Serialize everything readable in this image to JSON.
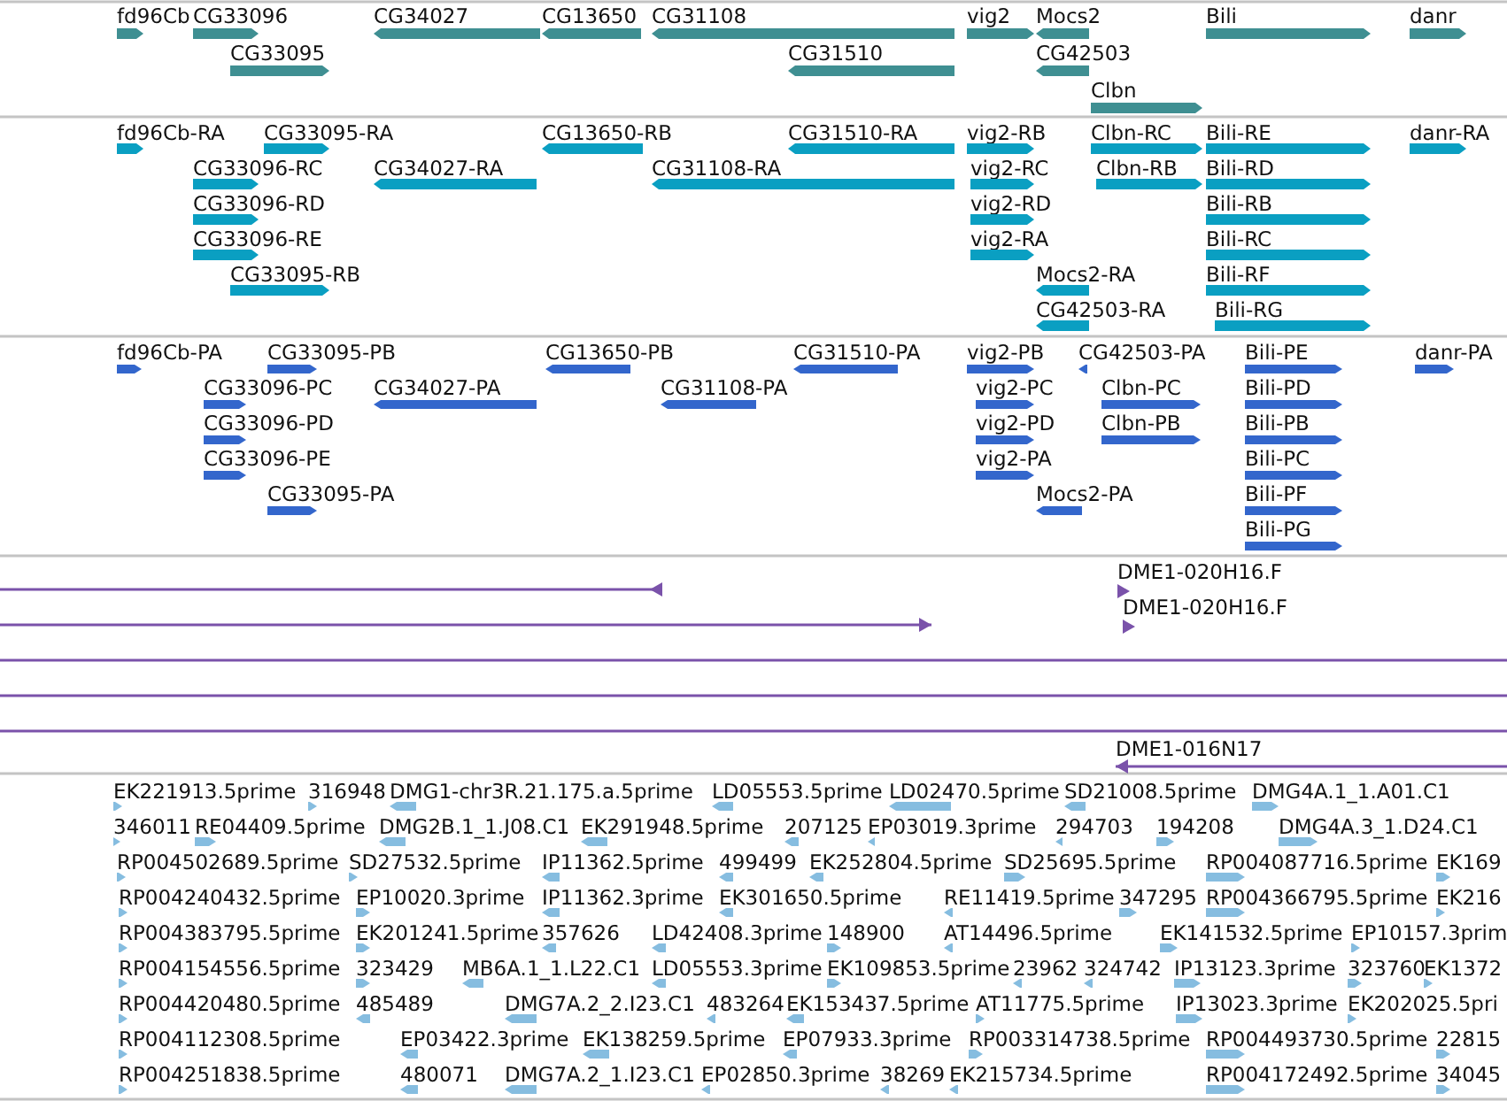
{
  "tracks": [
    {
      "kind": "gene",
      "rows": [
        {
          "features": [
            {
              "label": "fd96Cb",
              "reverse": false
            },
            {
              "label": "CG33096",
              "reverse": false
            },
            {
              "label": "CG34027",
              "reverse": true
            },
            {
              "label": "CG13650",
              "reverse": true
            },
            {
              "label": "CG31108",
              "reverse": true
            },
            {
              "label": "vig2",
              "reverse": false
            },
            {
              "label": "Mocs2",
              "reverse": true
            },
            {
              "label": "Bili",
              "reverse": false
            },
            {
              "label": "danr",
              "reverse": false
            }
          ]
        },
        {
          "features": [
            {
              "label": "CG33095",
              "reverse": false
            },
            {
              "label": "CG31510",
              "reverse": true
            },
            {
              "label": "CG42503",
              "reverse": true
            }
          ]
        },
        {
          "features": [
            {
              "label": "Clbn",
              "reverse": false
            }
          ]
        }
      ]
    },
    {
      "kind": "transcript",
      "rows": [
        {
          "features": [
            {
              "label": "fd96Cb-RA",
              "reverse": false
            },
            {
              "label": "CG33095-RA",
              "reverse": false
            },
            {
              "label": "CG13650-RB",
              "reverse": true
            },
            {
              "label": "CG31510-RA",
              "reverse": true
            },
            {
              "label": "vig2-RB",
              "reverse": false
            },
            {
              "label": "Clbn-RC",
              "reverse": false
            },
            {
              "label": "Bili-RE",
              "reverse": false
            },
            {
              "label": "danr-RA",
              "reverse": false
            }
          ]
        },
        {
          "features": [
            {
              "label": "CG33096-RC",
              "reverse": false
            },
            {
              "label": "CG34027-RA",
              "reverse": true
            },
            {
              "label": "CG31108-RA",
              "reverse": true
            },
            {
              "label": "vig2-RC",
              "reverse": false
            },
            {
              "label": "Clbn-RB",
              "reverse": false
            },
            {
              "label": "Bili-RD",
              "reverse": false
            }
          ]
        },
        {
          "features": [
            {
              "label": "CG33096-RD",
              "reverse": false
            },
            {
              "label": "vig2-RD",
              "reverse": false
            },
            {
              "label": "Bili-RB",
              "reverse": false
            }
          ]
        },
        {
          "features": [
            {
              "label": "CG33096-RE",
              "reverse": false
            },
            {
              "label": "vig2-RA",
              "reverse": false
            },
            {
              "label": "Bili-RC",
              "reverse": false
            }
          ]
        },
        {
          "features": [
            {
              "label": "CG33095-RB",
              "reverse": false
            },
            {
              "label": "Mocs2-RA",
              "reverse": true
            },
            {
              "label": "Bili-RF",
              "reverse": false
            }
          ]
        },
        {
          "features": [
            {
              "label": "CG42503-RA",
              "reverse": true
            },
            {
              "label": "Bili-RG",
              "reverse": false
            }
          ]
        }
      ]
    },
    {
      "kind": "protein",
      "rows": [
        {
          "features": [
            {
              "label": "fd96Cb-PA",
              "reverse": false
            },
            {
              "label": "CG33095-PB",
              "reverse": false
            },
            {
              "label": "CG13650-PB",
              "reverse": true
            },
            {
              "label": "CG31510-PA",
              "reverse": true
            },
            {
              "label": "vig2-PB",
              "reverse": false
            },
            {
              "label": "CG42503-PA",
              "reverse": true
            },
            {
              "label": "Bili-PE",
              "reverse": false
            },
            {
              "label": "danr-PA",
              "reverse": false
            }
          ]
        },
        {
          "features": [
            {
              "label": "CG33096-PC",
              "reverse": false
            },
            {
              "label": "CG34027-PA",
              "reverse": true
            },
            {
              "label": "CG31108-PA",
              "reverse": true
            },
            {
              "label": "vig2-PC",
              "reverse": false
            },
            {
              "label": "Clbn-PC",
              "reverse": false
            },
            {
              "label": "Bili-PD",
              "reverse": false
            }
          ]
        },
        {
          "features": [
            {
              "label": "CG33096-PD",
              "reverse": false
            },
            {
              "label": "vig2-PD",
              "reverse": false
            },
            {
              "label": "Clbn-PB",
              "reverse": false
            },
            {
              "label": "Bili-PB",
              "reverse": false
            }
          ]
        },
        {
          "features": [
            {
              "label": "CG33096-PE",
              "reverse": false
            },
            {
              "label": "vig2-PA",
              "reverse": false
            },
            {
              "label": "Bili-PC",
              "reverse": false
            }
          ]
        },
        {
          "features": [
            {
              "label": "CG33095-PA",
              "reverse": false
            },
            {
              "label": "Mocs2-PA",
              "reverse": true
            },
            {
              "label": "Bili-PF",
              "reverse": false
            }
          ]
        },
        {
          "features": [
            {
              "label": "Bili-PG",
              "reverse": false
            }
          ]
        }
      ]
    },
    {
      "kind": "clone",
      "rows": [
        {
          "features": [
            {
              "kind": "arrow",
              "reverse": true
            },
            {
              "kind": "marker",
              "label": "DME1-020H16.F",
              "reverse": false
            }
          ]
        },
        {
          "features": [
            {
              "kind": "arrow",
              "reverse": false
            },
            {
              "kind": "marker",
              "label": "DME1-020H16.F",
              "reverse": false
            }
          ]
        },
        {
          "features": [
            {
              "kind": "span"
            }
          ]
        },
        {
          "features": [
            {
              "kind": "span"
            }
          ]
        },
        {
          "features": [
            {
              "kind": "span"
            }
          ]
        },
        {
          "features": [
            {
              "kind": "arrow",
              "label": "DME1-016N17",
              "reverse": true
            }
          ]
        }
      ]
    },
    {
      "kind": "est",
      "rows": [
        {
          "features": [
            {
              "label": "EK221913.5prime",
              "reverse": false
            },
            {
              "label": "316948",
              "reverse": false
            },
            {
              "label": "DMG1-chr3R.21.175.a.5prime",
              "reverse": true
            },
            {
              "label": "LD05553.5prime",
              "reverse": true
            },
            {
              "label": "LD02470.5prime",
              "reverse": true
            },
            {
              "label": "SD21008.5prime",
              "reverse": true
            },
            {
              "label": "DMG4A.1_1.A01.C1",
              "reverse": false
            }
          ]
        },
        {
          "features": [
            {
              "label": "346011",
              "reverse": false
            },
            {
              "label": "RE04409.5prime",
              "reverse": false
            },
            {
              "label": "DMG2B.1_1.J08.C1",
              "reverse": true
            },
            {
              "label": "EK291948.5prime",
              "reverse": true
            },
            {
              "label": "207125",
              "reverse": true
            },
            {
              "label": "EP03019.3prime",
              "reverse": true
            },
            {
              "label": "294703",
              "reverse": true
            },
            {
              "label": "194208",
              "reverse": false
            },
            {
              "label": "DMG4A.3_1.D24.C1",
              "reverse": false
            }
          ]
        },
        {
          "features": [
            {
              "label": "RP004502689.5prime",
              "reverse": false
            },
            {
              "label": "SD27532.5prime",
              "reverse": false
            },
            {
              "label": "IP11362.5prime",
              "reverse": true
            },
            {
              "label": "499499",
              "reverse": true
            },
            {
              "label": "EK252804.5prime",
              "reverse": true
            },
            {
              "label": "SD25695.5prime",
              "reverse": false
            },
            {
              "label": "RP004087716.5prime",
              "reverse": false
            },
            {
              "label": "EK169",
              "reverse": false
            }
          ]
        },
        {
          "features": [
            {
              "label": "RP004240432.5prime",
              "reverse": false
            },
            {
              "label": "EP10020.3prime",
              "reverse": false
            },
            {
              "label": "IP11362.3prime",
              "reverse": true
            },
            {
              "label": "EK301650.5prime",
              "reverse": true
            },
            {
              "label": "RE11419.5prime",
              "reverse": true
            },
            {
              "label": "347295",
              "reverse": false
            },
            {
              "label": "RP004366795.5prime",
              "reverse": false
            },
            {
              "label": "EK216",
              "reverse": false
            }
          ]
        },
        {
          "features": [
            {
              "label": "RP004383795.5prime",
              "reverse": false
            },
            {
              "label": "EK201241.5prime",
              "reverse": false
            },
            {
              "label": "357626",
              "reverse": true
            },
            {
              "label": "LD42408.3prime",
              "reverse": true
            },
            {
              "label": "148900",
              "reverse": false
            },
            {
              "label": "AT14496.5prime",
              "reverse": true
            },
            {
              "label": "EK141532.5prime",
              "reverse": false
            },
            {
              "label": "EP10157.3prim",
              "reverse": false
            }
          ]
        },
        {
          "features": [
            {
              "label": "RP004154556.5prime",
              "reverse": false
            },
            {
              "label": "323429",
              "reverse": false
            },
            {
              "label": "MB6A.1_1.L22.C1",
              "reverse": true
            },
            {
              "label": "LD05553.3prime",
              "reverse": true
            },
            {
              "label": "EK109853.5prime",
              "reverse": false
            },
            {
              "label": "23962",
              "reverse": true
            },
            {
              "label": "324742",
              "reverse": true
            },
            {
              "label": "IP13123.3prime",
              "reverse": false
            },
            {
              "label": "323760",
              "reverse": false
            },
            {
              "label": "EK1372",
              "reverse": false
            }
          ]
        },
        {
          "features": [
            {
              "label": "RP004420480.5prime",
              "reverse": false
            },
            {
              "label": "485489",
              "reverse": true
            },
            {
              "label": "DMG7A.2_2.I23.C1",
              "reverse": true
            },
            {
              "label": "483264",
              "reverse": true
            },
            {
              "label": "EK153437.5prime",
              "reverse": true
            },
            {
              "label": "AT11775.5prime",
              "reverse": false
            },
            {
              "label": "IP13023.3prime",
              "reverse": false
            },
            {
              "label": "EK202025.5pri",
              "reverse": false
            }
          ]
        },
        {
          "features": [
            {
              "label": "RP004112308.5prime",
              "reverse": false
            },
            {
              "label": "EP03422.3prime",
              "reverse": true
            },
            {
              "label": "EK138259.5prime",
              "reverse": true
            },
            {
              "label": "EP07933.3prime",
              "reverse": true
            },
            {
              "label": "RP003314738.5prime",
              "reverse": false
            },
            {
              "label": "RP004493730.5prime",
              "reverse": false
            },
            {
              "label": "22815",
              "reverse": false
            }
          ]
        },
        {
          "features": [
            {
              "label": "RP004251838.5prime",
              "reverse": false
            },
            {
              "label": "480071",
              "reverse": true
            },
            {
              "label": "DMG7A.2_1.I23.C1",
              "reverse": true
            },
            {
              "label": "EP02850.3prime",
              "reverse": true
            },
            {
              "label": "38269",
              "reverse": true
            },
            {
              "label": "EK215734.5prime",
              "reverse": true
            },
            {
              "label": "RP004172492.5prime",
              "reverse": false
            },
            {
              "label": "34045",
              "reverse": false
            }
          ]
        }
      ]
    }
  ]
}
